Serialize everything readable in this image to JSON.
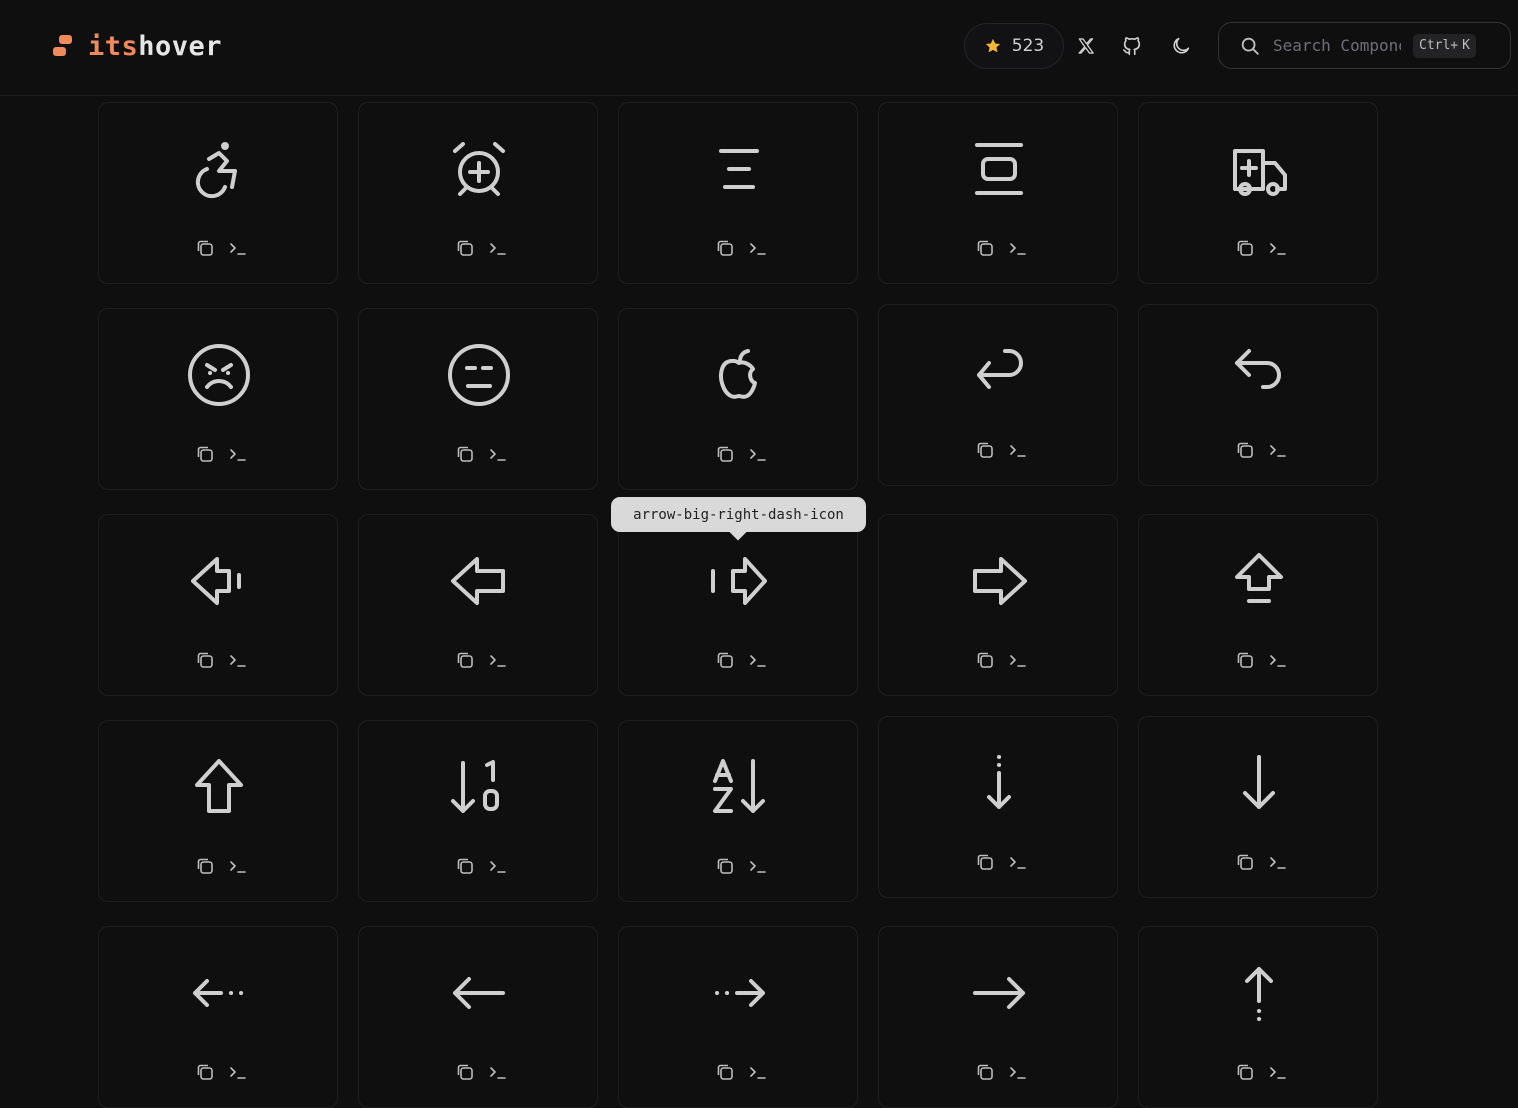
{
  "header": {
    "logo_prefix": "its",
    "logo_suffix": "hover",
    "brand_color": "#ef8a5a",
    "github_stars": "523",
    "icons": [
      "star-icon",
      "x-logo-icon",
      "github-icon",
      "moon-icon"
    ],
    "search": {
      "placeholder": "Search Components",
      "shortcut_mod": "Ctrl+",
      "shortcut_key": "K"
    }
  },
  "tooltip": {
    "text": "arrow-big-right-dash-icon"
  },
  "grid": {
    "icon_color": "#cfcfcf",
    "card_actions": [
      "copy-icon",
      "terminal-icon"
    ],
    "rows": [
      [
        "accessibility-icon",
        "alarm-clock-plus-icon",
        "align-center-icon",
        "align-vertical-center-icon",
        "ambulance-icon"
      ],
      [
        "angry-icon",
        "annoyed-icon",
        "apple-icon",
        "arrow-back-icon",
        "arrow-back-up-icon"
      ],
      [
        "arrow-big-left-dash-icon",
        "arrow-big-left-icon",
        "arrow-big-right-dash-icon",
        "arrow-big-right-icon",
        "arrow-big-up-dash-icon"
      ],
      [
        "arrow-big-up-icon",
        "arrow-down-1-0-icon",
        "arrow-down-a-z-icon",
        "arrow-down-from-dots-icon",
        "arrow-down-icon"
      ],
      [
        "arrow-left-from-dots-icon",
        "arrow-left-icon",
        "arrow-right-from-dots-icon",
        "arrow-right-icon",
        "arrow-up-from-dots-icon"
      ]
    ]
  }
}
